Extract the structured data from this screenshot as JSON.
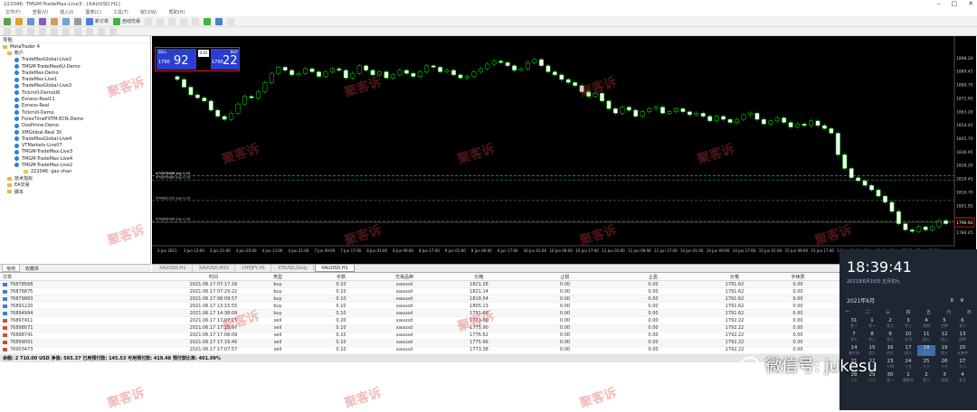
{
  "window": {
    "title": "222046: TMGM-TradeMax-Live3 - [XAUUSD,H1]"
  },
  "menu": [
    "文件(F)",
    "查看(V)",
    "插入(I)",
    "图表(C)",
    "工具(T)",
    "窗口(W)",
    "帮助(H)"
  ],
  "toolbar": {
    "new_order": "新订单",
    "auto_trade": "自动交易"
  },
  "navigator": {
    "title": "导航",
    "root": "MetaTrader 4",
    "accounts_label": "账户",
    "accounts": [
      "TradeMaxGlobal-Live2",
      "TMGM-TradeMaxAU-Demo",
      "TradeMax-Demo",
      "TradeMax-Live1",
      "TradeMaxGlobal-Live3",
      "Tickmill-DemoUK",
      "Exness-Real11",
      "Exness-Real",
      "Tickmill-Demo",
      "ForexTimeFXTM-ECN-Demo",
      "DooPrime-Demo",
      "XMGlobal-Real 30",
      "TradeMaxGlobal-Live4",
      "VTMarkets-Live07",
      "TMGM-TradeMax-Live3",
      "TMGM-TradeMax-Live4",
      "TMGM-TradeMax-Live2"
    ],
    "sub_account": "222046: gao zhan",
    "folders": [
      "技术指标",
      "EA交易",
      "脚本"
    ],
    "tabs": [
      "常用",
      "收藏夹"
    ]
  },
  "one_click": {
    "sell_label": "SELL",
    "buy_label": "BUY",
    "lot": "0.01",
    "sell_price_prefix": "1790",
    "sell_price": "92",
    "buy_price_prefix": "1790",
    "buy_price": "22"
  },
  "chart_tabs": [
    "XAUUSD,H1",
    "XAUUSD,M15",
    "CHFJPY,H1",
    "XTIUSD,Daily",
    "XAUUSD,H1"
  ],
  "chart_tabs_active": 4,
  "chart_data": {
    "type": "candlestick",
    "symbol": "XAUUSD,H1",
    "x_labels": [
      "2 Jun 2021",
      "3 Jun 13:00",
      "3 Jun 21:00",
      "4 Jun 05:00",
      "4 Jun 13:00",
      "4 Jun 21:00",
      "7 Jun 09:00",
      "7 Jun 17:00",
      "8 Jun 01:00",
      "8 Jun 09:00",
      "8 Jun 17:00",
      "9 Jun 01:00",
      "9 Jun 09:00",
      "9 Jun 17:00",
      "10 Jun 01:00",
      "10 Jun 09:00",
      "10 Jun 17:00",
      "11 Jun 01:00",
      "11 Jun 09:00",
      "11 Jun 17:00",
      "14 Jun 01:00",
      "14 Jun 09:00",
      "14 Jun 17:00",
      "15 Jun 01:00",
      "15 Jun 09:00",
      "15 Jun 17:00",
      "16 Jun 01:00",
      "16 Jun 09:00",
      "16 Jun 17:00",
      "17 Jun 01:00"
    ],
    "y_ticks": [
      "1898.20",
      "1889.45",
      "1880.70",
      "1871.95",
      "1863.20",
      "1854.45",
      "1845.70",
      "1836.95",
      "1828.20",
      "1819.45",
      "1810.70",
      "1801.95",
      "1793.20",
      "1784.45"
    ],
    "ylim": [
      1778,
      1904
    ],
    "closes": [
      1884,
      1879,
      1874,
      1872,
      1870,
      1864,
      1860,
      1858,
      1862,
      1868,
      1873,
      1872,
      1876,
      1882,
      1888,
      1892,
      1890,
      1887,
      1888,
      1891,
      1889,
      1886,
      1889,
      1891,
      1890,
      1885,
      1888,
      1893,
      1890,
      1887,
      1889,
      1885,
      1887,
      1890,
      1888,
      1886,
      1889,
      1893,
      1892,
      1889,
      1890,
      1887,
      1885,
      1886,
      1889,
      1891,
      1894,
      1896,
      1895,
      1893,
      1890,
      1891,
      1895,
      1897,
      1893,
      1889,
      1887,
      1884,
      1882,
      1880,
      1876,
      1873,
      1875,
      1870,
      1865,
      1862,
      1866,
      1864,
      1860,
      1863,
      1865,
      1866,
      1862,
      1863,
      1865,
      1863,
      1861,
      1862,
      1860,
      1857,
      1860,
      1858,
      1856,
      1858,
      1861,
      1862,
      1858,
      1855,
      1857,
      1859,
      1856,
      1853,
      1855,
      1854,
      1857,
      1854,
      1852,
      1849,
      1835,
      1826,
      1820,
      1818,
      1815,
      1812,
      1808,
      1804,
      1798,
      1790,
      1786,
      1785,
      1788,
      1786,
      1788,
      1792,
      1790
    ],
    "order_lines": [
      {
        "label": "#76878568 buy 0.10",
        "price": 1821.26
      },
      {
        "label": "#76878875 buy 0.10",
        "price": 1821.14
      },
      {
        "label": "#76879883 buy 0.10",
        "price": 1818.54
      },
      {
        "label": "#76891220 buy 0.10",
        "price": 1805.13
      },
      {
        "label": "#76894994 buy 0.10",
        "price": 1791.6
      }
    ],
    "current_price": "1790.92"
  },
  "terminal": {
    "columns": [
      "订单",
      "时间",
      "类型",
      "手数",
      "交易品种",
      "价格",
      "止损",
      "止盈",
      "价格",
      "手续费"
    ],
    "rows": [
      {
        "order": "76878568",
        "time": "2021.06.17 07:17:16",
        "type": "buy",
        "lots": "0.10",
        "symbol": "xauusd",
        "price": "1821.26",
        "sl": "0.00",
        "tp": "0.00",
        "cur": "1791.62",
        "fee": "0.00"
      },
      {
        "order": "76878875",
        "time": "2021.06.17 07:29:22",
        "type": "buy",
        "lots": "0.10",
        "symbol": "xauusd",
        "price": "1821.14",
        "sl": "0.00",
        "tp": "0.00",
        "cur": "1791.62",
        "fee": "0.00"
      },
      {
        "order": "76879883",
        "time": "2021.06.17 08:09:57",
        "type": "buy",
        "lots": "0.10",
        "symbol": "xauusd",
        "price": "1818.54",
        "sl": "0.00",
        "tp": "0.00",
        "cur": "1791.62",
        "fee": "0.00"
      },
      {
        "order": "76891220",
        "time": "2021.06.17 13:15:55",
        "type": "buy",
        "lots": "0.10",
        "symbol": "xauusd",
        "price": "1805.13",
        "sl": "0.00",
        "tp": "0.00",
        "cur": "1791.62",
        "fee": "0.00"
      },
      {
        "order": "76894994",
        "time": "2021.06.17 14:38:09",
        "type": "buy",
        "lots": "0.10",
        "symbol": "xauusd",
        "price": "1791.60",
        "sl": "0.00",
        "tp": "0.00",
        "cur": "1791.62",
        "fee": "0.00"
      },
      {
        "order": "76897411",
        "time": "2021.06.17 17:07:15",
        "type": "sell",
        "lots": "0.20",
        "symbol": "xauusd",
        "price": "1773.60",
        "sl": "0.00",
        "tp": "0.00",
        "cur": "1792.22",
        "fee": "0.00"
      },
      {
        "order": "76898071",
        "time": "2021.06.17 17:25:57",
        "type": "sell",
        "lots": "0.10",
        "symbol": "xauusd",
        "price": "1775.90",
        "sl": "0.00",
        "tp": "0.00",
        "cur": "1792.22",
        "fee": "0.00"
      },
      {
        "order": "76898741",
        "time": "2021.06.17 17:06:09",
        "type": "sell",
        "lots": "0.10",
        "symbol": "xauusd",
        "price": "1776.62",
        "sl": "0.00",
        "tp": "0.00",
        "cur": "1792.22",
        "fee": "0.00"
      },
      {
        "order": "76899051",
        "time": "2021.06.17 17:16:45",
        "type": "sell",
        "lots": "0.10",
        "symbol": "xauusd",
        "price": "1775.66",
        "sl": "0.00",
        "tp": "0.00",
        "cur": "1792.22",
        "fee": "0.00"
      },
      {
        "order": "76903473",
        "time": "2021.06.17 17:07:57",
        "type": "sell",
        "lots": "0.10",
        "symbol": "xauusd",
        "price": "1773.38",
        "sl": "0.00",
        "tp": "0.00",
        "cur": "1792.22",
        "fee": "0.00"
      }
    ],
    "summary": "余额: 2 710.00 USD  净值: 565.37  已用预付款: 145.53  可用预付款: 419.48  预付款比率: 401.09%"
  },
  "clock": {
    "time": "18:39:41",
    "date": "2021年6月18日 五月初九",
    "month": "2021年6月",
    "arrows": "∧∨",
    "weekdays": [
      "一",
      "二",
      "三",
      "四",
      "五",
      "六",
      "日"
    ],
    "days": [
      {
        "d": "31",
        "l": "廿一"
      },
      {
        "d": "1",
        "l": "廿一"
      },
      {
        "d": "2",
        "l": "廿二"
      },
      {
        "d": "3",
        "l": "廿三"
      },
      {
        "d": "4",
        "l": "廿四"
      },
      {
        "d": "5",
        "l": "芒种"
      },
      {
        "d": "6",
        "l": "廿六"
      },
      {
        "d": "7",
        "l": "廿七"
      },
      {
        "d": "8",
        "l": "廿八"
      },
      {
        "d": "9",
        "l": "廿九"
      },
      {
        "d": "10",
        "l": "五月"
      },
      {
        "d": "11",
        "l": "初二"
      },
      {
        "d": "12",
        "l": "初三"
      },
      {
        "d": "13",
        "l": "初四"
      },
      {
        "d": "14",
        "l": "端午节"
      },
      {
        "d": "15",
        "l": "初六"
      },
      {
        "d": "16",
        "l": "初七"
      },
      {
        "d": "17",
        "l": "初八"
      },
      {
        "d": "18",
        "l": "初九"
      },
      {
        "d": "19",
        "l": "初十"
      },
      {
        "d": "20",
        "l": "父亲节"
      },
      {
        "d": "21",
        "l": "夏至"
      },
      {
        "d": "22",
        "l": "十三"
      },
      {
        "d": "23",
        "l": "十四"
      },
      {
        "d": "24",
        "l": "十五"
      },
      {
        "d": "25",
        "l": "十六"
      },
      {
        "d": "26",
        "l": "十七"
      },
      {
        "d": "27",
        "l": "十八"
      },
      {
        "d": "28",
        "l": "十九"
      },
      {
        "d": "29",
        "l": "二十"
      },
      {
        "d": "30",
        "l": "廿一"
      },
      {
        "d": "1",
        "l": "建党节"
      },
      {
        "d": "2",
        "l": "廿三"
      },
      {
        "d": "3",
        "l": "廿四"
      },
      {
        "d": "4",
        "l": "廿五"
      }
    ],
    "today_index": 18
  },
  "watermark": {
    "text": "聚客诉",
    "wechat": "微信号: jukesu"
  }
}
